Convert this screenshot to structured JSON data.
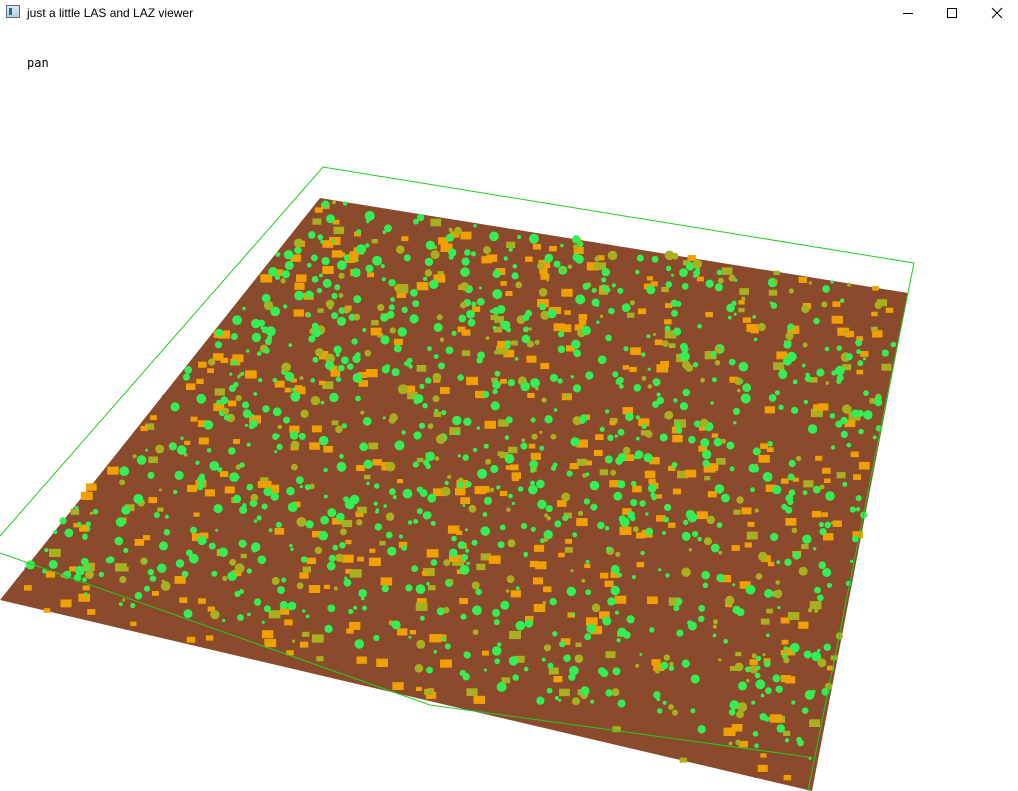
{
  "window": {
    "title": "just a little LAS and LAZ viewer",
    "icon": "app-window-icon",
    "buttons": {
      "minimize": "minimize-icon",
      "maximize": "maximize-icon",
      "close": "close-icon"
    }
  },
  "viewer": {
    "mode_label": "pan",
    "colors": {
      "background": "#ffffff",
      "bounding_box": "#22cc22",
      "ground": "#8b4a2b",
      "roof": "#f0a000",
      "vegetation": "#33ee55",
      "mid_vegetation": "#a8b020",
      "dark_points": "#555555",
      "red_points": "#cc2222"
    }
  }
}
